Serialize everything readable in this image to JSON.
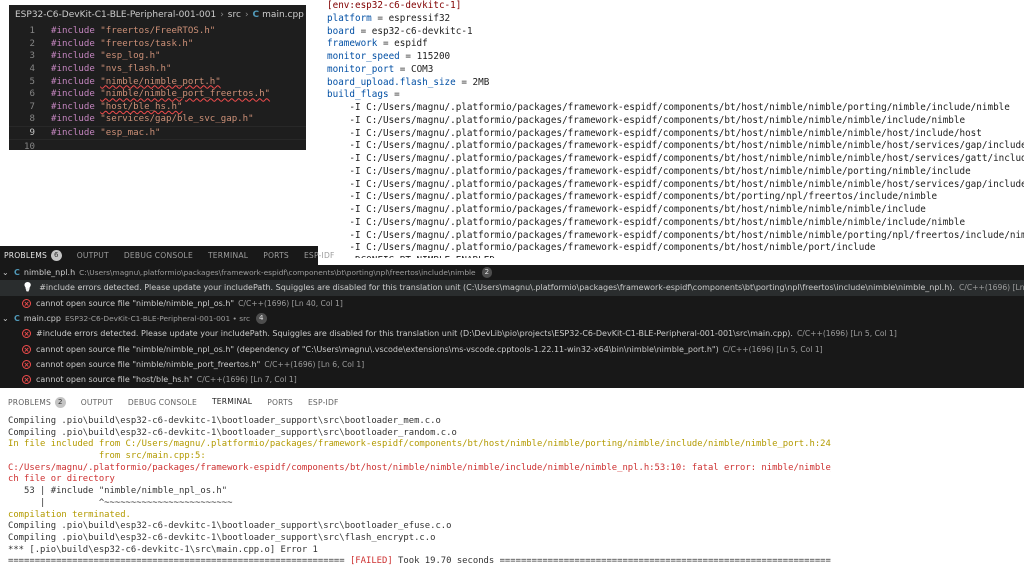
{
  "editor": {
    "breadcrumb": {
      "project": "ESP32-C6-DevKit-C1-BLE-Peripheral-001-001",
      "folder": "src",
      "file_icon": "C",
      "file": "main.cpp",
      "more": "..."
    },
    "lines": [
      {
        "num": "1",
        "kw": "#include",
        "str": "\"freertos/FreeRTOS.h\"",
        "squiggle": false
      },
      {
        "num": "2",
        "kw": "#include",
        "str": "\"freertos/task.h\"",
        "squiggle": false
      },
      {
        "num": "3",
        "kw": "#include",
        "str": "\"esp_log.h\"",
        "squiggle": false
      },
      {
        "num": "4",
        "kw": "#include",
        "str": "\"nvs_flash.h\"",
        "squiggle": false
      },
      {
        "num": "5",
        "kw": "#include",
        "str": "\"nimble/nimble_port.h\"",
        "squiggle": true
      },
      {
        "num": "6",
        "kw": "#include",
        "str": "\"nimble/nimble_port_freertos.h\"",
        "squiggle": true
      },
      {
        "num": "7",
        "kw": "#include",
        "str": "\"host/ble_hs.h\"",
        "squiggle": true
      },
      {
        "num": "8",
        "kw": "#include",
        "str": "\"services/gap/ble_svc_gap.h\"",
        "squiggle": false
      },
      {
        "num": "9",
        "kw": "#include",
        "str": "\"esp_mac.h\"",
        "squiggle": false
      },
      {
        "num": "10",
        "kw": "",
        "str": "",
        "squiggle": false
      }
    ]
  },
  "ini": {
    "section": "[env:esp32-c6-devkitc-1]",
    "entries": [
      {
        "key": "platform",
        "value": "espressif32"
      },
      {
        "key": "board",
        "value": "esp32-c6-devkitc-1"
      },
      {
        "key": "framework",
        "value": "espidf"
      },
      {
        "key": "monitor_speed",
        "value": "115200"
      },
      {
        "key": "monitor_port",
        "value": "COM3"
      },
      {
        "key": "board_upload.flash_size",
        "value": "2MB"
      },
      {
        "key": "build_flags",
        "value": ""
      }
    ],
    "flags": [
      "-I C:/Users/magnu/.platformio/packages/framework-espidf/components/bt/host/nimble/nimble/porting/nimble/include/nimble",
      "-I C:/Users/magnu/.platformio/packages/framework-espidf/components/bt/host/nimble/nimble/nimble/include/nimble",
      "-I C:/Users/magnu/.platformio/packages/framework-espidf/components/bt/host/nimble/nimble/nimble/host/include/host",
      "-I C:/Users/magnu/.platformio/packages/framework-espidf/components/bt/host/nimble/nimble/nimble/host/services/gap/include/services/gap",
      "-I C:/Users/magnu/.platformio/packages/framework-espidf/components/bt/host/nimble/nimble/nimble/host/services/gatt/include/services/gatt",
      "-I C:/Users/magnu/.platformio/packages/framework-espidf/components/bt/host/nimble/nimble/porting/nimble/include",
      "-I C:/Users/magnu/.platformio/packages/framework-espidf/components/bt/host/nimble/nimble/nimble/host/services/gap/include",
      "-I C:/Users/magnu/.platformio/packages/framework-espidf/components/bt/porting/npl/freertos/include/nimble",
      "-I C:/Users/magnu/.platformio/packages/framework-espidf/components/bt/host/nimble/nimble/nimble/include",
      "-I C:/Users/magnu/.platformio/packages/framework-espidf/components/bt/host/nimble/nimble/nimble/include/nimble",
      "-I C:/Users/magnu/.platformio/packages/framework-espidf/components/bt/host/nimble/nimble/porting/npl/freertos/include/nimble",
      "-I C:/Users/magnu/.platformio/packages/framework-espidf/components/bt/host/nimble/port/include",
      "-DCONFIG_BT_NIMBLE_ENABLED"
    ]
  },
  "panel_tabs": {
    "problems": "PROBLEMS",
    "problems_count": "6",
    "output": "OUTPUT",
    "debug_console": "DEBUG CONSOLE",
    "terminal": "TERMINAL",
    "ports": "PORTS",
    "esp_idf": "ESP-IDF"
  },
  "problems": {
    "groups": [
      {
        "file": "nimble_npl.h",
        "path": "C:\\Users\\magnu\\.platformio\\packages\\framework-espidf\\components\\bt\\porting\\npl\\freertos\\include\\nimble",
        "count": "2",
        "items": [
          {
            "icon": "lightbulb-icon",
            "msg": "#include errors detected. Please update your includePath. Squiggles are disabled for this translation unit (C:\\Users\\magnu\\.platformio\\packages\\framework-espidf\\components\\bt\\porting\\npl\\freertos\\include\\nimble\\nimble_npl.h).",
            "src": "C/C++(1696)  [Ln 40, Col 1]",
            "selected": true
          },
          {
            "icon": "error-icon",
            "msg": "cannot open source file \"nimble/nimble_npl_os.h\"",
            "src": "C/C++(1696)  [Ln 40, Col 1]",
            "selected": false
          }
        ]
      },
      {
        "file": "main.cpp",
        "path": "ESP32-C6-DevKit-C1-BLE-Peripheral-001-001 • src",
        "count": "4",
        "items": [
          {
            "icon": "error-icon",
            "msg": "#include errors detected. Please update your includePath. Squiggles are disabled for this translation unit (D:\\DevLib\\pio\\projects\\ESP32-C6-DevKit-C1-BLE-Peripheral-001-001\\src\\main.cpp).",
            "src": "C/C++(1696)  [Ln 5, Col 1]",
            "selected": false
          },
          {
            "icon": "error-icon",
            "msg": "cannot open source file \"nimble/nimble_npl_os.h\" (dependency of \"C:\\Users\\magnu\\.vscode\\extensions\\ms-vscode.cpptools-1.22.11-win32-x64\\bin\\nimble\\nimble_port.h\")",
            "src": "C/C++(1696)  [Ln 5, Col 1]",
            "selected": false
          },
          {
            "icon": "error-icon",
            "msg": "cannot open source file \"nimble/nimble_port_freertos.h\"",
            "src": "C/C++(1696)  [Ln 6, Col 1]",
            "selected": false
          },
          {
            "icon": "error-icon",
            "msg": "cannot open source file \"host/ble_hs.h\"",
            "src": "C/C++(1696)  [Ln 7, Col 1]",
            "selected": false
          }
        ]
      }
    ]
  },
  "terminal_tabs": {
    "problems": "PROBLEMS",
    "problems_count": "2",
    "output": "OUTPUT",
    "debug_console": "DEBUG CONSOLE",
    "terminal": "TERMINAL",
    "ports": "PORTS",
    "esp_idf": "ESP-IDF"
  },
  "terminal": {
    "lines": [
      {
        "text": "Compiling .pio\\build\\esp32-c6-devkitc-1\\bootloader_support\\src\\bootloader_mem.c.o",
        "style": "normal"
      },
      {
        "text": "Compiling .pio\\build\\esp32-c6-devkitc-1\\bootloader_support\\src\\bootloader_random.c.o",
        "style": "normal"
      },
      {
        "text": "In file included from C:/Users/magnu/.platformio/packages/framework-espidf/components/bt/host/nimble/nimble/porting/nimble/include/nimble/nimble_port.h:24,",
        "style": "yellow"
      },
      {
        "text": "                 from src/main.cpp:5:",
        "style": "yellow"
      },
      {
        "text": "C:/Users/magnu/.platformio/packages/framework-espidf/components/bt/host/nimble/nimble/nimble/include/nimble/nimble_npl.h:53:10: fatal error: nimble/nimble_npl_os.h: No su",
        "style": "red"
      },
      {
        "text": "ch file or directory",
        "style": "red"
      },
      {
        "text": "   53 | #include \"nimble/nimble_npl_os.h\"",
        "style": "normal"
      },
      {
        "text": "      |          ^~~~~~~~~~~~~~~~~~~~~~~~~",
        "style": "normal"
      },
      {
        "text": "compilation terminated.",
        "style": "yellow"
      },
      {
        "text": "Compiling .pio\\build\\esp32-c6-devkitc-1\\bootloader_support\\src\\bootloader_efuse.c.o",
        "style": "normal"
      },
      {
        "text": "Compiling .pio\\build\\esp32-c6-devkitc-1\\bootloader_support\\src\\flash_encrypt.c.o",
        "style": "normal"
      },
      {
        "text": "*** [.pio\\build\\esp32-c6-devkitc-1\\src\\main.cpp.o] Error 1",
        "style": "normal"
      }
    ],
    "summary": {
      "left": "=============================================================== ",
      "status": "[FAILED]",
      "right": " Took 19.70 seconds ==============================================================="
    }
  }
}
